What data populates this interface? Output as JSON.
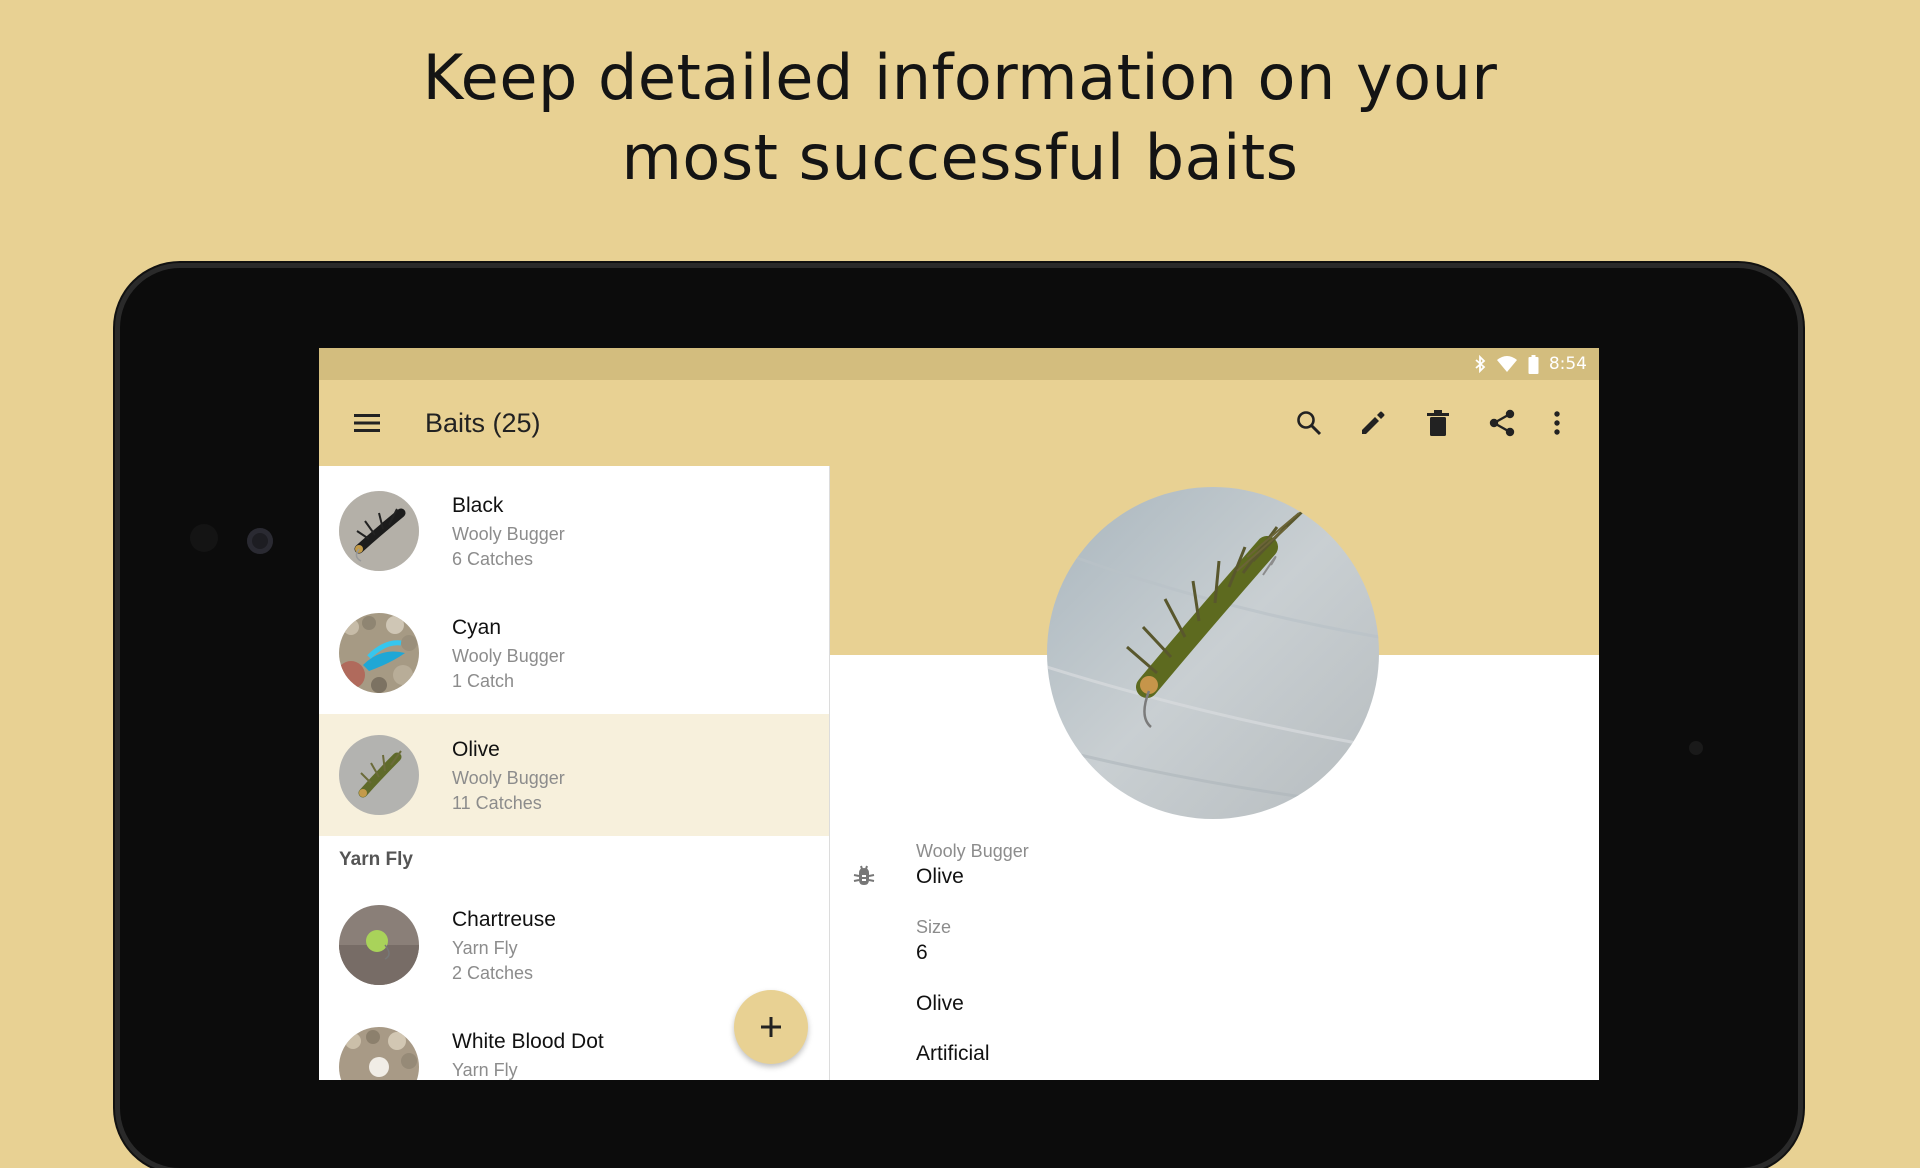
{
  "headline": {
    "line1": "Keep detailed information on your",
    "line2": "most successful baits"
  },
  "status_bar": {
    "time": "8:54",
    "icons": [
      "bluetooth-icon",
      "wifi-icon",
      "battery-icon"
    ]
  },
  "app_bar": {
    "title": "Baits (25)",
    "actions": [
      "search-icon",
      "edit-icon",
      "delete-icon",
      "share-icon",
      "more-vert-icon"
    ]
  },
  "list": {
    "items": [
      {
        "title": "Black",
        "subtitle": "Wooly Bugger",
        "count": "6 Catches"
      },
      {
        "title": "Cyan",
        "subtitle": "Wooly Bugger",
        "count": "1 Catch"
      },
      {
        "title": "Olive",
        "subtitle": "Wooly Bugger",
        "count": "11 Catches"
      },
      {
        "title": "Chartreuse",
        "subtitle": "Yarn Fly",
        "count": "2 Catches"
      },
      {
        "title": "White Blood Dot",
        "subtitle": "Yarn Fly",
        "count": ""
      }
    ],
    "section_yarn_fly": "Yarn Fly",
    "fab_icon": "add-icon"
  },
  "detail": {
    "category": "Wooly Bugger",
    "name": "Olive",
    "size_label": "Size",
    "size_value": "6",
    "color_value": "Olive",
    "type_value": "Artificial"
  },
  "colors": {
    "accent": "#e8d193",
    "status_bar": "#d3bd7e",
    "selected_row": "#f7f0dc"
  }
}
